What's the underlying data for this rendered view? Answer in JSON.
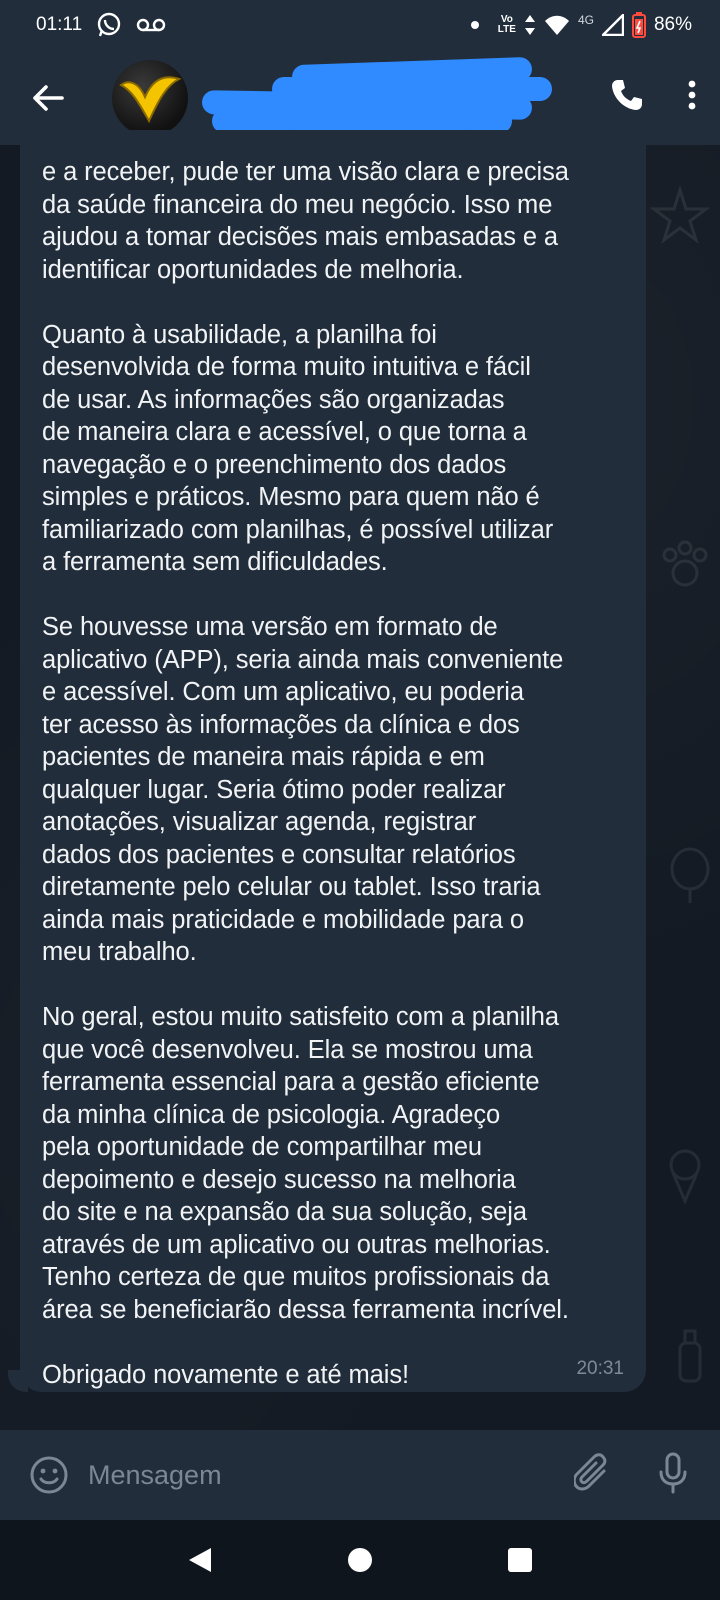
{
  "status_bar": {
    "time": "01:11",
    "volte_top": "Vo",
    "volte_bottom": "LTE",
    "network": "4G",
    "battery": "86%",
    "icons": [
      "whatsapp-icon",
      "voicemail-icon",
      "dot-icon",
      "volte-icon",
      "data-arrows-icon",
      "wifi-icon",
      "signal-icon",
      "battery-icon"
    ]
  },
  "header": {
    "back_icon": "arrow-left-icon",
    "avatar": "contact-avatar",
    "call_icon": "phone-icon",
    "menu_icon": "more-vertical-icon"
  },
  "message": {
    "text": "e a receber, pude ter uma visão clara e precisa\nda saúde financeira do meu negócio. Isso me\najudou a tomar decisões mais embasadas e a\nidentificar oportunidades de melhoria.\n\nQuanto à usabilidade, a planilha foi\ndesenvolvida de forma muito intuitiva e fácil\nde usar. As informações são organizadas\nde maneira clara e acessível, o que torna a\nnavegação e o preenchimento dos dados\nsimples e práticos. Mesmo para quem não é\nfamiliarizado com planilhas, é possível utilizar\na ferramenta sem dificuldades.\n\nSe houvesse uma versão em formato de\naplicativo (APP), seria ainda mais conveniente\ne acessível. Com um aplicativo, eu poderia\nter acesso às informações da clínica e dos\npacientes de maneira mais rápida e em\nqualquer lugar. Seria ótimo poder realizar\nanotações, visualizar agenda, registrar\ndados dos pacientes e consultar relatórios\ndiretamente pelo celular ou tablet. Isso traria\nainda mais praticidade e mobilidade para o\nmeu trabalho.\n\nNo geral, estou muito satisfeito com a planilha\nque você desenvolveu. Ela se mostrou uma\nferramenta essencial para a gestão eficiente\nda minha clínica de psicologia. Agradeço\npela oportunidade de compartilhar meu\ndepoimento e desejo sucesso na melhoria\ndo site e na expansão da sua solução, seja\natravés de um aplicativo ou outras melhorias.\nTenho certeza de que muitos profissionais da\nárea se beneficiarão dessa ferramenta incrível.\n\nObrigado novamente e até mais!",
    "time": "20:31"
  },
  "input": {
    "placeholder": "Mensagem",
    "emoji_icon": "smiley-icon",
    "attach_icon": "paperclip-icon",
    "mic_icon": "microphone-icon"
  },
  "nav": {
    "back": "triangle-back-icon",
    "home": "circle-home-icon",
    "recents": "square-recents-icon"
  },
  "colors": {
    "bar_bg": "#212d3b",
    "chat_bg": "#131a23",
    "bubble_bg": "#212d3b",
    "text": "#f1f3f5",
    "time": "#7c8b99",
    "redaction": "#2f8bff",
    "battery_red": "#ff4b3e"
  }
}
